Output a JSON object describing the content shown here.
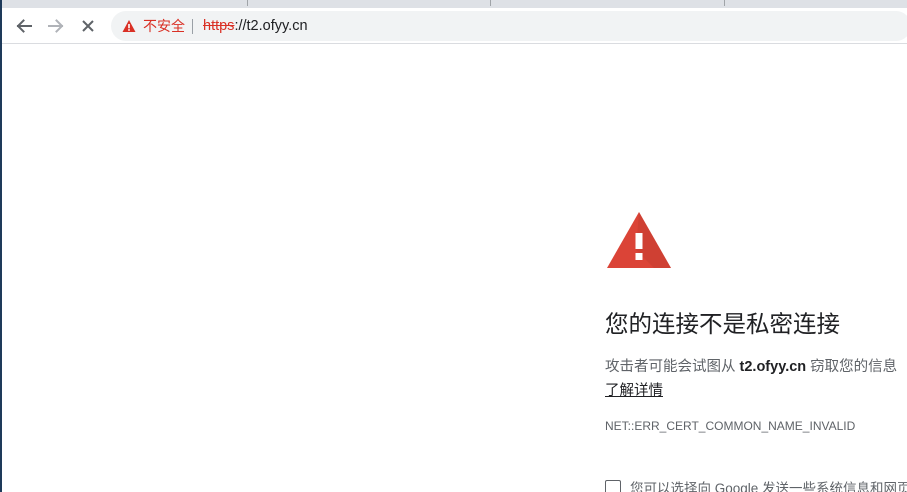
{
  "browser": {
    "back_icon": "arrow-left-icon",
    "forward_icon": "arrow-right-icon",
    "stop_icon": "close-icon",
    "security_label": "不安全",
    "url_scheme": "https",
    "url_rest": "://t2.ofyy.cn",
    "accent_warning": "#d93025"
  },
  "interstitial": {
    "icon": "warning-triangle-icon",
    "icon_color": "#db4437",
    "title": "您的连接不是私密连接",
    "desc_prefix": "攻击者可能会试图从 ",
    "desc_host": "t2.ofyy.cn",
    "desc_suffix": " 窃取您的信息",
    "learn_more": "了解详情",
    "error_code": "NET::ERR_CERT_COMMON_NAME_INVALID",
    "optin_text": "您可以选择向 Google 发送一些系统信息和网页内容"
  }
}
